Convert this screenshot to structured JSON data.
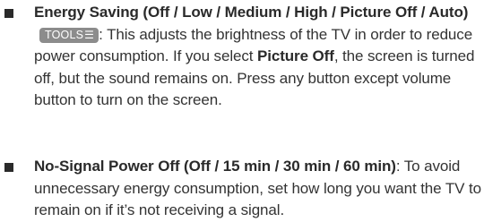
{
  "items": [
    {
      "title": "Energy Saving (Off / Low / Medium / High / Picture Off / Auto)",
      "badge": "TOOLS",
      "badge_icon": "tools-icon",
      "desc_before": ": This adjusts the brightness of the TV in order to reduce power consumption. If you select ",
      "desc_bold": "Picture Off",
      "desc_after": ", the screen is turned off, but the sound remains on. Press any button except volume button to turn on the screen."
    },
    {
      "title": "No-Signal Power Off (Off / 15 min / 30 min / 60 min)",
      "desc": ": To avoid unnecessary energy consumption, set how long you want the TV to remain on if it’s not receiving a signal."
    }
  ]
}
